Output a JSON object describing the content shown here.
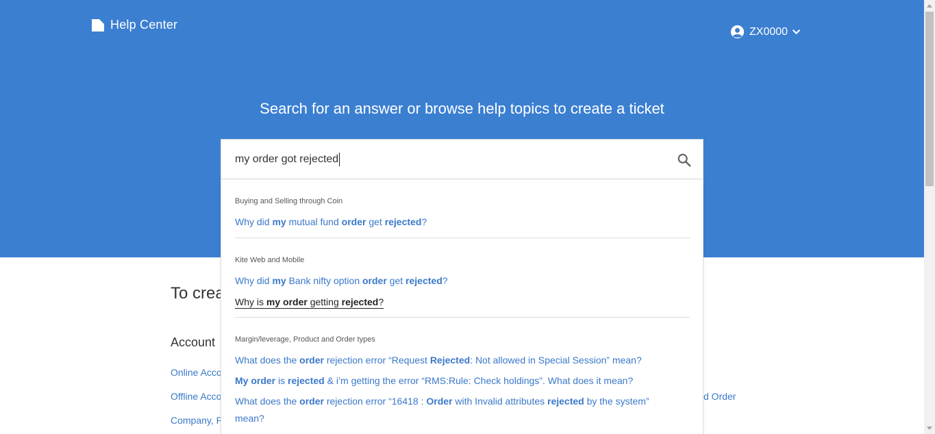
{
  "header": {
    "logo_label": "Help Center",
    "user_name": "ZX0000"
  },
  "hero": {
    "title": "Search for an answer or browse help topics to create a ticket"
  },
  "search": {
    "value": "my order got rejected"
  },
  "results": {
    "groups": [
      {
        "title": "Buying and Selling through Coin",
        "items": [
          {
            "text": "Why did my mutual fund order get rejected?"
          }
        ]
      },
      {
        "title": "Kite Web and Mobile",
        "items": [
          {
            "text": "Why did my Bank nifty option order get rejected?"
          },
          {
            "text": "Why is my order getting rejected?"
          }
        ]
      },
      {
        "title": "Margin/leverage, Product and Order types",
        "items": [
          {
            "text": "What does the order rejection error “Request Rejected: Not allowed in Special Session” mean?"
          },
          {
            "text": "My order is rejected & i’m getting the error “RMS:Rule: Check holdings”. What does it mean?"
          },
          {
            "text": "What does the order rejection error “16418 : Order with Invalid attributes rejected by the system” mean?"
          }
        ]
      }
    ]
  },
  "background": {
    "section_heading_partial": "To crea",
    "account_heading": "Account",
    "links": [
      "Online Acco",
      "Offline Acco",
      "Company, P"
    ],
    "right_link_partial": "d Order"
  },
  "colors": {
    "hero_bg": "#3b7fd1",
    "link": "#3a78c9"
  }
}
